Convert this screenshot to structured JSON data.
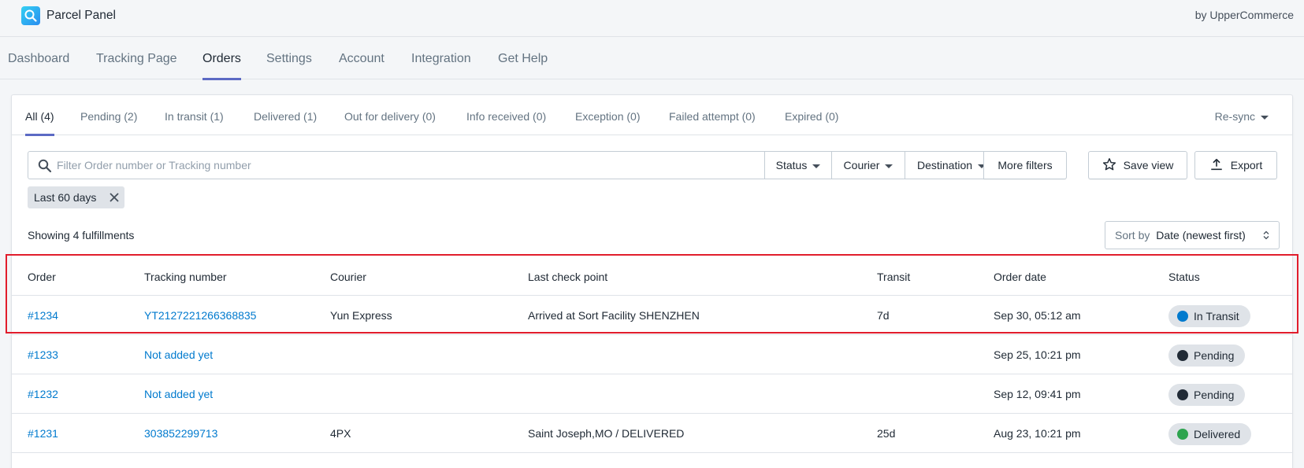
{
  "app": {
    "title": "Parcel Panel",
    "by": "by UpperCommerce",
    "logo": "magnifier-logo-icon"
  },
  "nav": {
    "items": [
      {
        "label": "Dashboard"
      },
      {
        "label": "Tracking Page"
      },
      {
        "label": "Orders",
        "active": true
      },
      {
        "label": "Settings"
      },
      {
        "label": "Account"
      },
      {
        "label": "Integration"
      },
      {
        "label": "Get Help"
      }
    ]
  },
  "tabs": {
    "items": [
      {
        "label": "All (4)",
        "active": true
      },
      {
        "label": "Pending (2)"
      },
      {
        "label": "In transit (1)"
      },
      {
        "label": "Delivered (1)"
      },
      {
        "label": "Out for delivery (0)"
      },
      {
        "label": "Info received (0)"
      },
      {
        "label": "Exception (0)"
      },
      {
        "label": "Failed attempt (0)"
      },
      {
        "label": "Expired (0)"
      }
    ],
    "resync": "Re-sync"
  },
  "filters": {
    "placeholder": "Filter Order number or Tracking number",
    "value": "",
    "status": "Status",
    "courier": "Courier",
    "destination": "Destination",
    "more": "More filters",
    "save_view": "Save view",
    "export": "Export",
    "chip": "Last 60 days"
  },
  "summary": {
    "showing": "Showing 4 fulfillments"
  },
  "sort": {
    "label": "Sort by",
    "value": "Date (newest first)"
  },
  "table": {
    "headers": [
      "Order",
      "Tracking number",
      "Courier",
      "Last check point",
      "Transit",
      "Order date",
      "Status"
    ],
    "rows": [
      {
        "order": "#1234",
        "tracking": "YT2127221266368835",
        "courier": "Yun Express",
        "checkpoint": "Arrived at Sort Facility SHENZHEN",
        "transit": "7d",
        "date": "Sep 30, 05:12 am",
        "status": "In Transit",
        "status_color": "#007ace"
      },
      {
        "order": "#1233",
        "tracking": "Not added yet",
        "courier": "",
        "checkpoint": "",
        "transit": "",
        "date": "Sep 25, 10:21 pm",
        "status": "Pending",
        "status_color": "#212b36"
      },
      {
        "order": "#1232",
        "tracking": "Not added yet",
        "courier": "",
        "checkpoint": "",
        "transit": "",
        "date": "Sep 12, 09:41 pm",
        "status": "Pending",
        "status_color": "#212b36"
      },
      {
        "order": "#1231",
        "tracking": "303852299713",
        "courier": "4PX",
        "checkpoint": "Saint Joseph,MO / DELIVERED",
        "transit": "25d",
        "date": "Aug 23, 10:21 pm",
        "status": "Delivered",
        "status_color": "#2ea44f"
      }
    ]
  },
  "colors": {
    "accent": "#5c6ac4",
    "link": "#007ace",
    "highlight": "#e11d2c"
  }
}
